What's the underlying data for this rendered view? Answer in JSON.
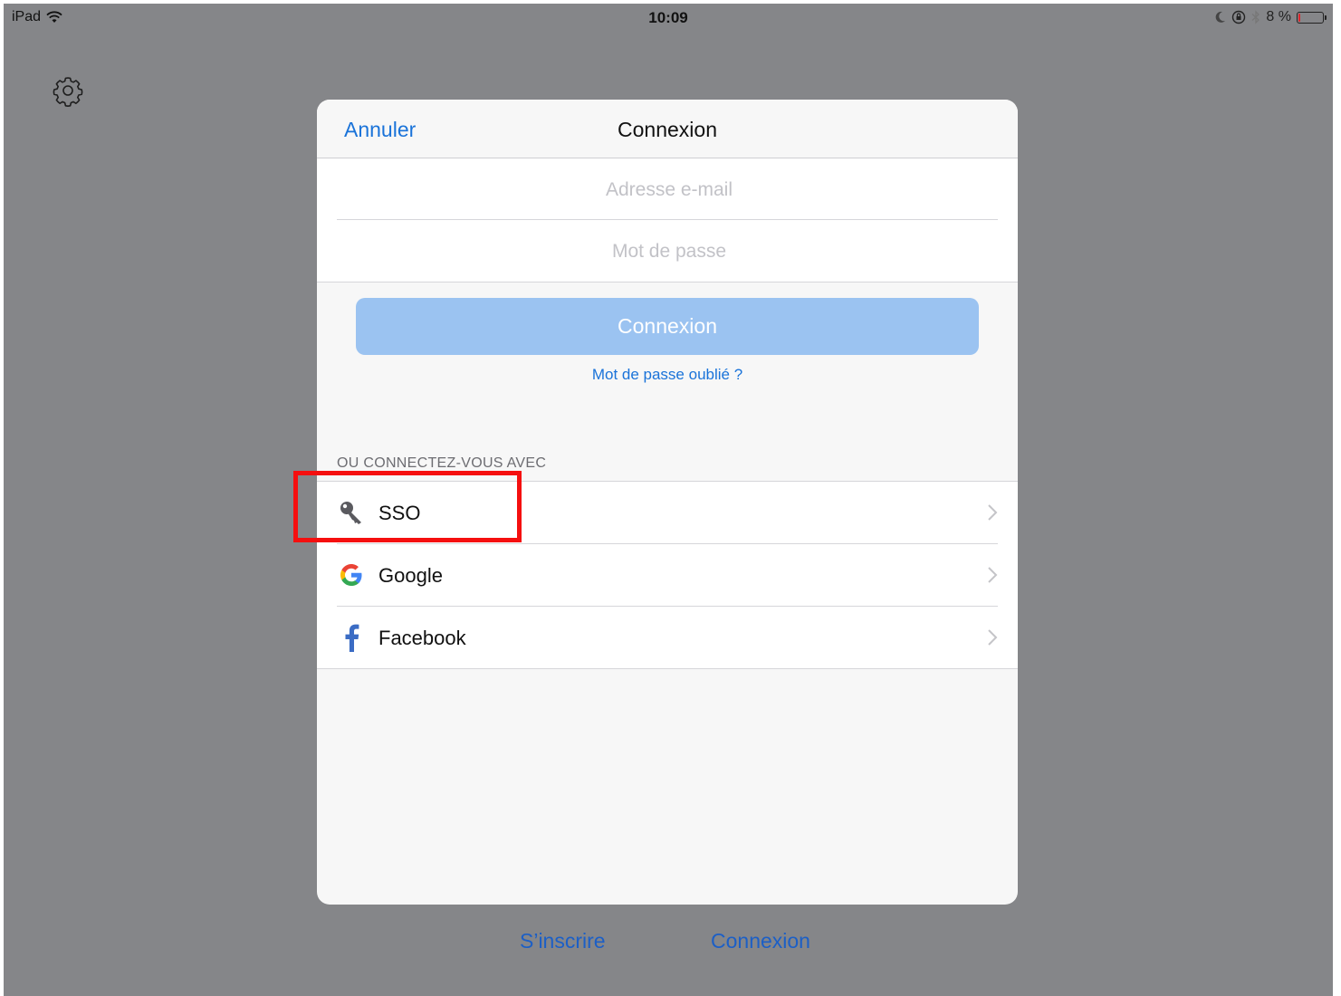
{
  "statusbar": {
    "device": "iPad",
    "time": "10:09",
    "battery_text": "8 %",
    "battery_level": 0.08
  },
  "modal": {
    "cancel_label": "Annuler",
    "title": "Connexion",
    "email_placeholder": "Adresse e-mail",
    "password_placeholder": "Mot de passe",
    "login_button_label": "Connexion",
    "forgot_password_label": "Mot de passe oublié ?",
    "section_header": "OU CONNECTEZ-VOUS AVEC",
    "providers": [
      {
        "label": "SSO",
        "icon": "key-icon"
      },
      {
        "label": "Google",
        "icon": "google-icon"
      },
      {
        "label": "Facebook",
        "icon": "facebook-icon"
      }
    ]
  },
  "bottom": {
    "signup_label": "S’inscrire",
    "login_label": "Connexion"
  },
  "colors": {
    "accent": "#1a73d9",
    "disabled_button": "#9bc3f1",
    "overlay": "#858689",
    "highlight": "#f50f0f"
  }
}
